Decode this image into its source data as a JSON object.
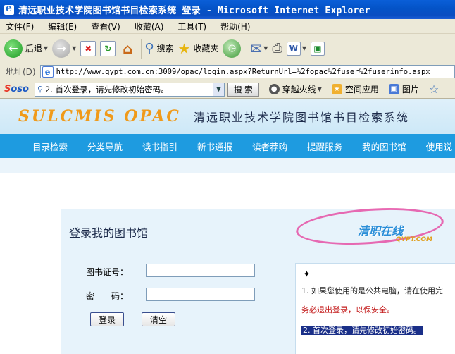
{
  "window": {
    "title": "清远职业技术学院图书馆书目检索系统 登录 - Microsoft Internet Explorer"
  },
  "menu": [
    "文件(F)",
    "编辑(E)",
    "查看(V)",
    "收藏(A)",
    "工具(T)",
    "帮助(H)"
  ],
  "toolbar": {
    "back_label": "后退",
    "search_label": "搜索",
    "favorites_label": "收藏夹"
  },
  "address": {
    "label": "地址(D)",
    "url": "http://www.qypt.com.cn:3009/opac/login.aspx?ReturnUrl=%2fopac%2fuser%2fuserinfo.aspx"
  },
  "search_toolbar": {
    "logo_a": "S",
    "logo_b": "oso",
    "search_value": "2. 首次登录，请先修改初始密码。",
    "search_button": "搜 索",
    "item1": "穿越火线",
    "item2": "空间应用",
    "item3": "图片"
  },
  "site": {
    "logo": "SULCMIS OPAC",
    "name": "清远职业技术学院图书馆书目检索系统",
    "nav": [
      "目录检索",
      "分类导航",
      "读书指引",
      "新书通报",
      "读者荐购",
      "提醒服务",
      "我的图书馆",
      "使用说"
    ]
  },
  "login": {
    "title": "登录我的图书馆",
    "card_label": "图书证号：",
    "password_label": "密　　码：",
    "login_button": "登录",
    "clear_button": "清空"
  },
  "notice": {
    "pin": "✦",
    "line1": "1. 如果您使用的是公共电脑，请在使用完",
    "line2": "务必退出登录，以保安全。",
    "line3": "2. 首次登录，请先修改初始密码。"
  },
  "watermark": {
    "text": "清职在线",
    "sub": "QYPT.COM"
  }
}
